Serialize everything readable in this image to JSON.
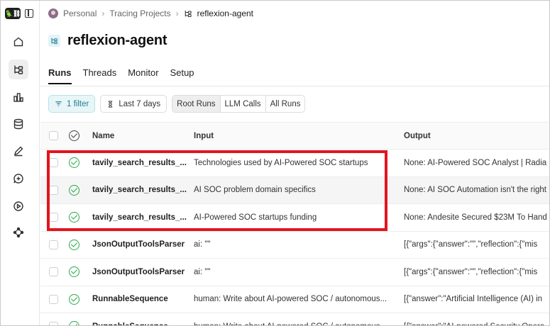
{
  "app": {
    "logo_text": "🦜⛓"
  },
  "sidebar": {
    "items": [
      {
        "id": "home",
        "icon": "home-icon"
      },
      {
        "id": "tracing",
        "icon": "tracing-projects-icon",
        "active": true
      },
      {
        "id": "monitoring",
        "icon": "bar-chart-icon"
      },
      {
        "id": "datasets",
        "icon": "database-icon"
      },
      {
        "id": "annotation",
        "icon": "pen-icon"
      },
      {
        "id": "prompts",
        "icon": "chat-plus-icon"
      },
      {
        "id": "deployments",
        "icon": "play-circle-icon"
      },
      {
        "id": "more",
        "icon": "graph-nodes-icon"
      }
    ]
  },
  "breadcrumb": {
    "workspace": "Personal",
    "section": "Tracing Projects",
    "current": "reflexion-agent"
  },
  "page": {
    "title": "reflexion-agent"
  },
  "tabs": [
    {
      "label": "Runs",
      "active": true
    },
    {
      "label": "Threads"
    },
    {
      "label": "Monitor"
    },
    {
      "label": "Setup"
    }
  ],
  "filters": {
    "filter_label": "1 filter",
    "time_label": "Last 7 days",
    "run_types": [
      "Root Runs",
      "LLM Calls",
      "All Runs"
    ],
    "active_run_type": "Root Runs"
  },
  "table": {
    "columns": {
      "name": "Name",
      "input": "Input",
      "output": "Output"
    },
    "rows": [
      {
        "name": "tavily_search_results_...",
        "input": "Technologies used by AI-Powered SOC startups",
        "output": "None: AI-Powered SOC Analyst | Radia",
        "status": "success",
        "highlighted": false
      },
      {
        "name": "tavily_search_results_...",
        "input": "AI SOC problem domain specifics",
        "output": "None: AI SOC Automation isn't the right",
        "status": "success",
        "highlighted": true
      },
      {
        "name": "tavily_search_results_...",
        "input": "AI-Powered SOC startups funding",
        "output": "None: Andesite Secured $23M To Hand",
        "status": "success",
        "highlighted": false
      },
      {
        "name": "JsonOutputToolsParser",
        "input": "ai: \"\"",
        "output": "[{\"args\":{\"answer\":\"\",\"reflection\":{\"mis",
        "status": "success",
        "highlighted": false
      },
      {
        "name": "JsonOutputToolsParser",
        "input": "ai: \"\"",
        "output": "[{\"args\":{\"answer\":\"\",\"reflection\":{\"mis",
        "status": "success",
        "highlighted": false
      },
      {
        "name": "RunnableSequence",
        "input": "human: Write about AI-powered SOC / autonomous...",
        "output": "[{\"answer\":\"Artificial Intelligence (AI) in",
        "status": "success",
        "highlighted": false
      },
      {
        "name": "RunnableSequence",
        "input": "human: Write about AI-powered SOC / autonomous...",
        "output": "[{\"answer\":\"AI-powered Security Opera",
        "status": "success",
        "highlighted": false
      }
    ]
  },
  "colors": {
    "success": "#2aa84a",
    "accent": "#1f7f93",
    "highlight_box": "#e3141d"
  }
}
